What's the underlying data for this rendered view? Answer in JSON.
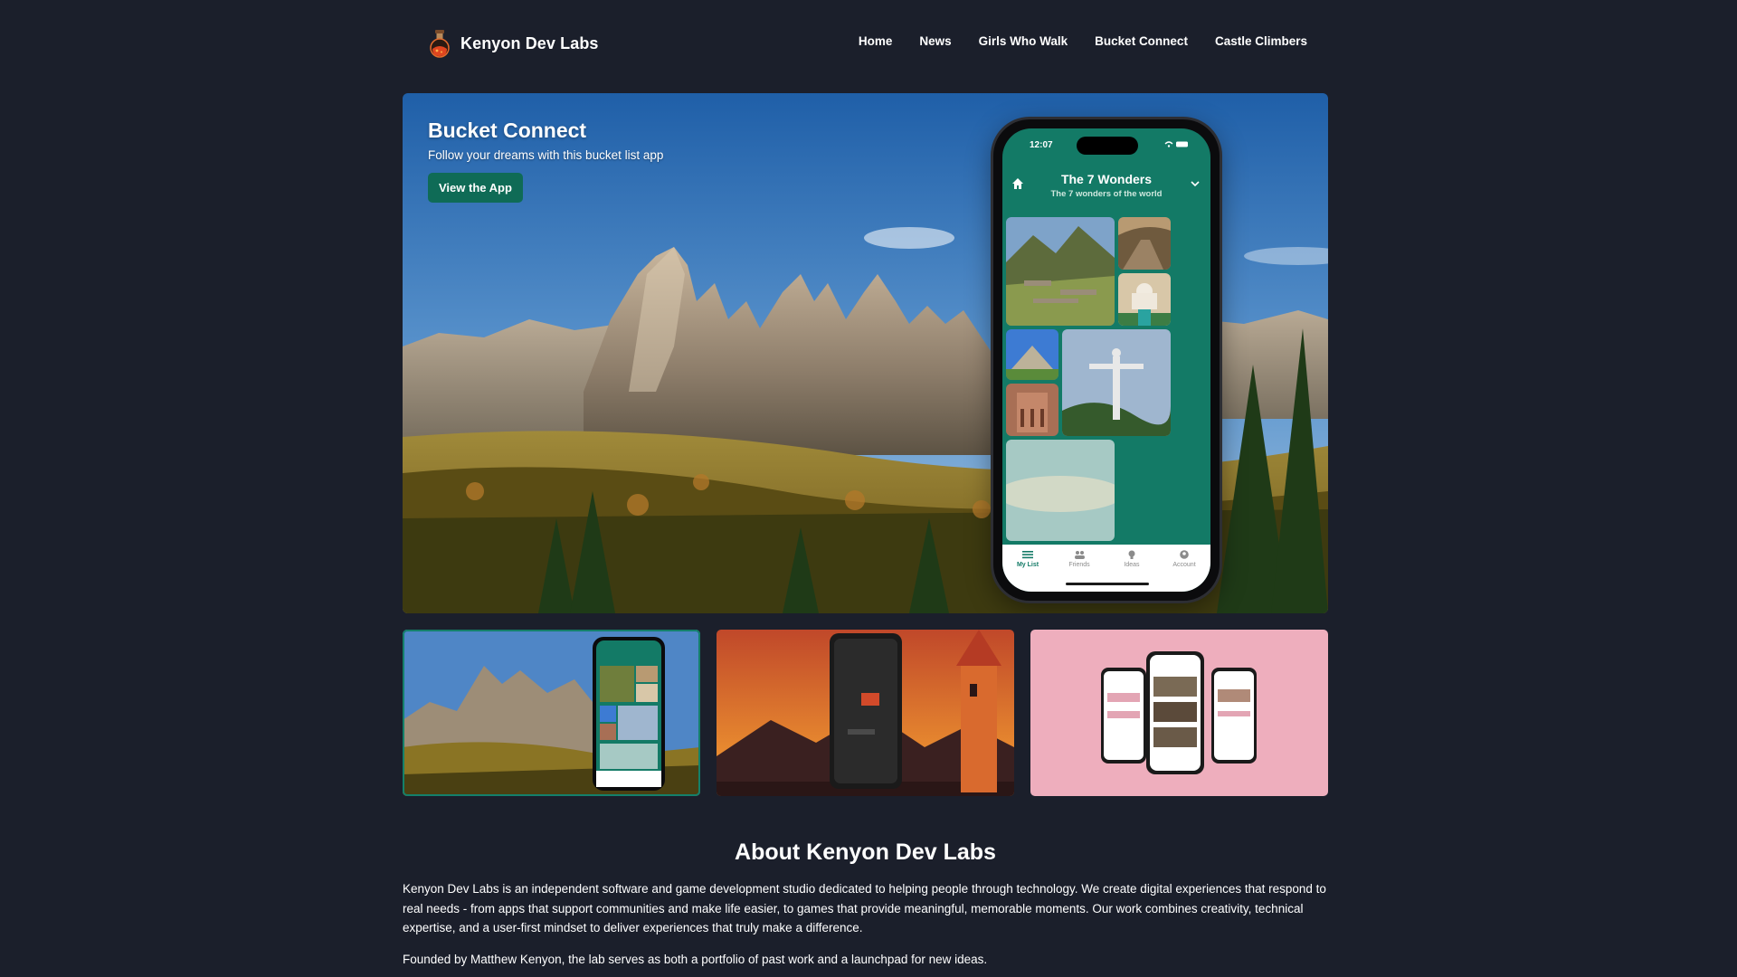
{
  "brand": {
    "name": "Kenyon Dev Labs",
    "logo_icon": "flask-logo-icon"
  },
  "nav": {
    "links": [
      "Home",
      "News",
      "Girls Who Walk",
      "Bucket Connect",
      "Castle Climbers"
    ]
  },
  "hero": {
    "title": "Bucket Connect",
    "subtitle": "Follow your dreams with this bucket list app",
    "cta_label": "View the App"
  },
  "phone": {
    "time": "12:07",
    "list_title": "The 7 Wonders",
    "list_subtitle": "The 7 wonders of the world",
    "tabs": [
      "My List",
      "Friends",
      "Ideas",
      "Account"
    ],
    "active_tab": "My List"
  },
  "thumbnails": [
    {
      "name": "Bucket Connect",
      "selected": true,
      "bg": "#14806a"
    },
    {
      "name": "Castle Climbers",
      "selected": false,
      "bg": "#c0542a"
    },
    {
      "name": "Girls Who Walk",
      "selected": false,
      "bg": "#eeaebd"
    }
  ],
  "about": {
    "title": "About Kenyon Dev Labs",
    "paragraph_1": "Kenyon Dev Labs is an independent software and game development studio dedicated to helping people through technology. We create digital experiences that respond to real needs - from apps that support communities and make life easier, to games that provide meaningful, memorable moments. Our work combines creativity, technical expertise, and a user-first mindset to deliver experiences that truly make a difference.",
    "paragraph_2": "Founded by Matthew Kenyon, the lab serves as both a portfolio of past work and a launchpad for new ideas."
  },
  "colors": {
    "background": "#1b1f2b",
    "accent": "#0f6b56",
    "app_green": "#137a66"
  }
}
